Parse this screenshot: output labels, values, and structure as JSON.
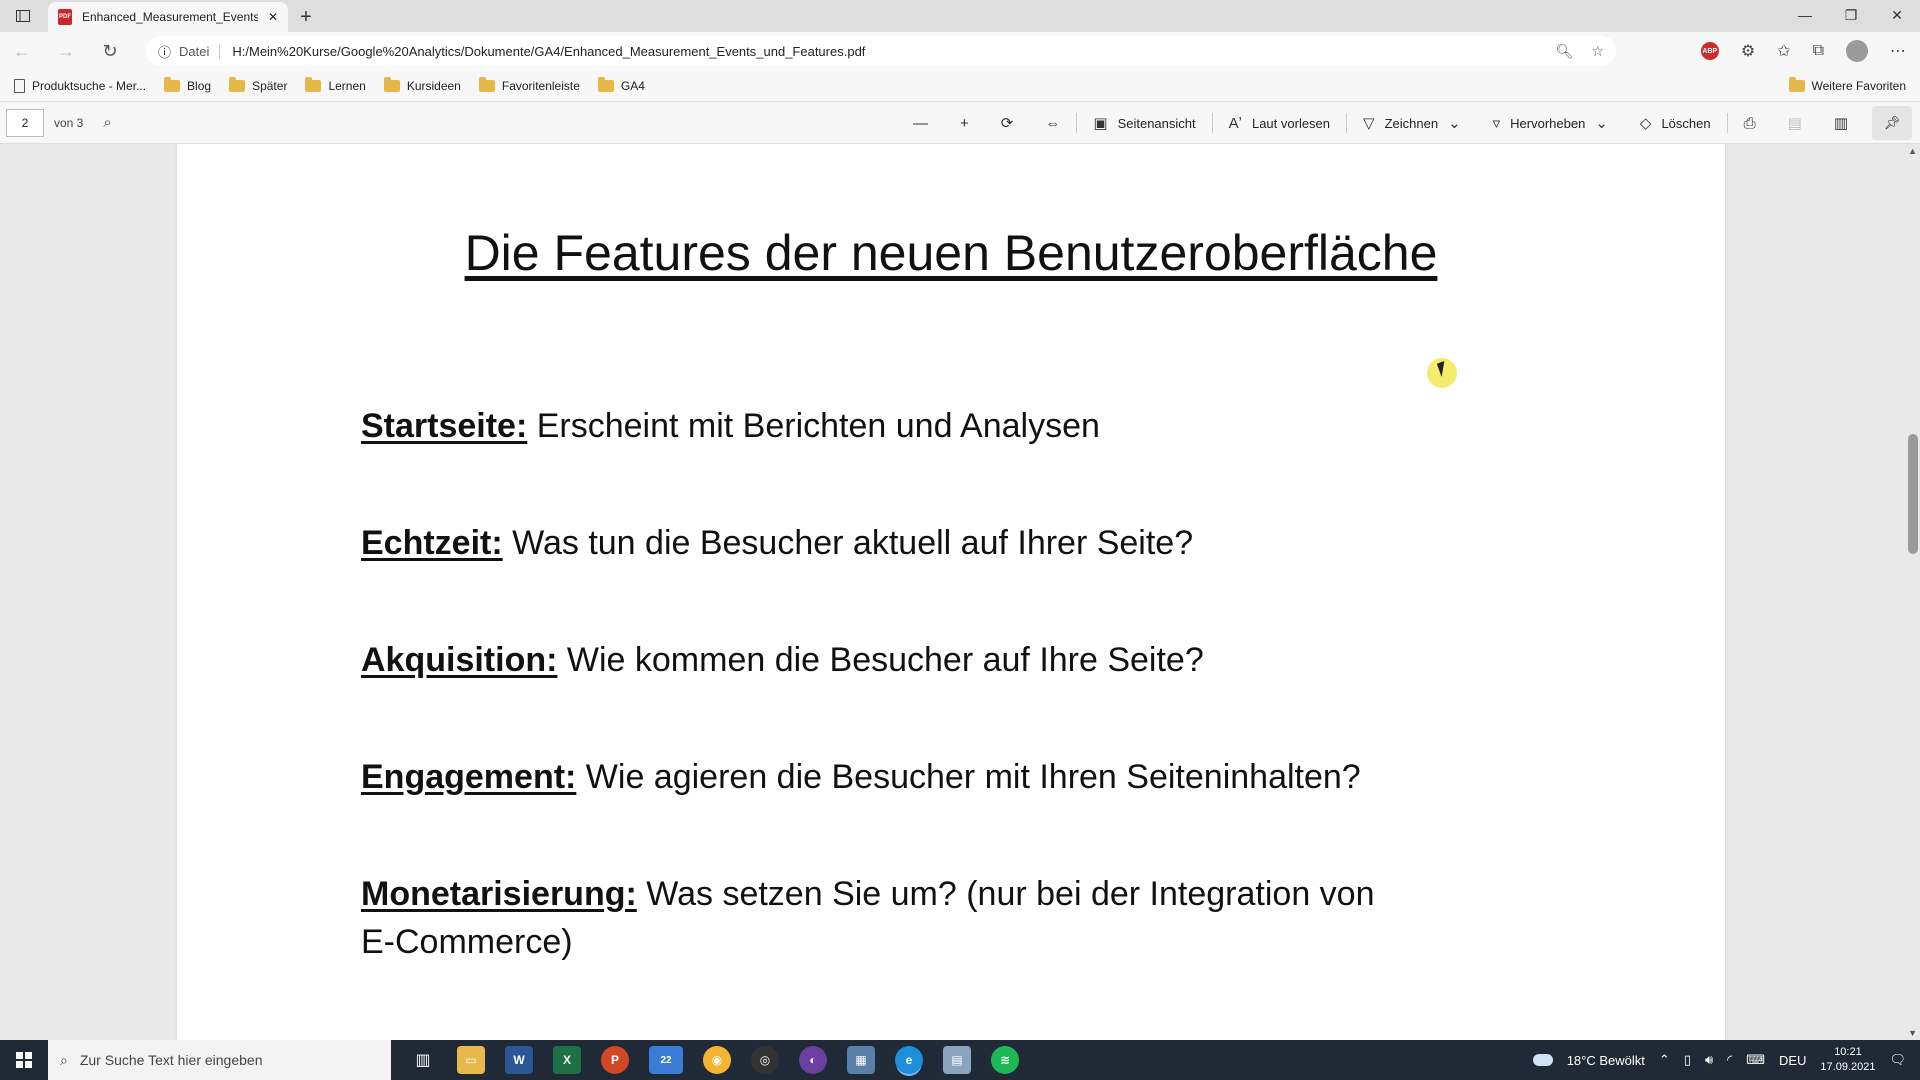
{
  "browser": {
    "tab_title": "Enhanced_Measurement_Events_",
    "address_scheme_label": "Datei",
    "url": "H:/Mein%20Kurse/Google%20Analytics/Dokumente/GA4/Enhanced_Measurement_Events_und_Features.pdf"
  },
  "bookmarks": {
    "items": [
      "Produktsuche - Mer...",
      "Blog",
      "Später",
      "Lernen",
      "Kursideen",
      "Favoritenleiste",
      "GA4"
    ],
    "more": "Weitere Favoriten"
  },
  "pdf_toolbar": {
    "page_current": "2",
    "page_total": "von 3",
    "page_view": "Seitenansicht",
    "read_aloud": "Laut vorlesen",
    "draw": "Zeichnen",
    "highlight": "Hervorheben",
    "erase": "Löschen"
  },
  "document": {
    "title": "Die Features der neuen Benutzeroberfläche",
    "items": [
      {
        "label": "Startseite:",
        "text": " Erscheint mit Berichten und Analysen"
      },
      {
        "label": "Echtzeit:",
        "text": " Was tun die Besucher aktuell auf Ihrer Seite?"
      },
      {
        "label": "Akquisition:",
        "text": " Wie kommen die Besucher auf Ihre Seite?"
      },
      {
        "label": "Engagement:",
        "text": " Wie agieren die Besucher mit Ihren Seiteninhalten?"
      },
      {
        "label": "Monetarisierung:",
        "text": " Was setzen Sie um? (nur bei der Integration von E-Commerce)"
      }
    ]
  },
  "taskbar": {
    "search_placeholder": "Zur Suche Text hier eingeben",
    "mail_badge": "22",
    "weather": "18°C  Bewölkt",
    "language": "DEU",
    "time": "10:21",
    "date": "17.09.2021"
  }
}
